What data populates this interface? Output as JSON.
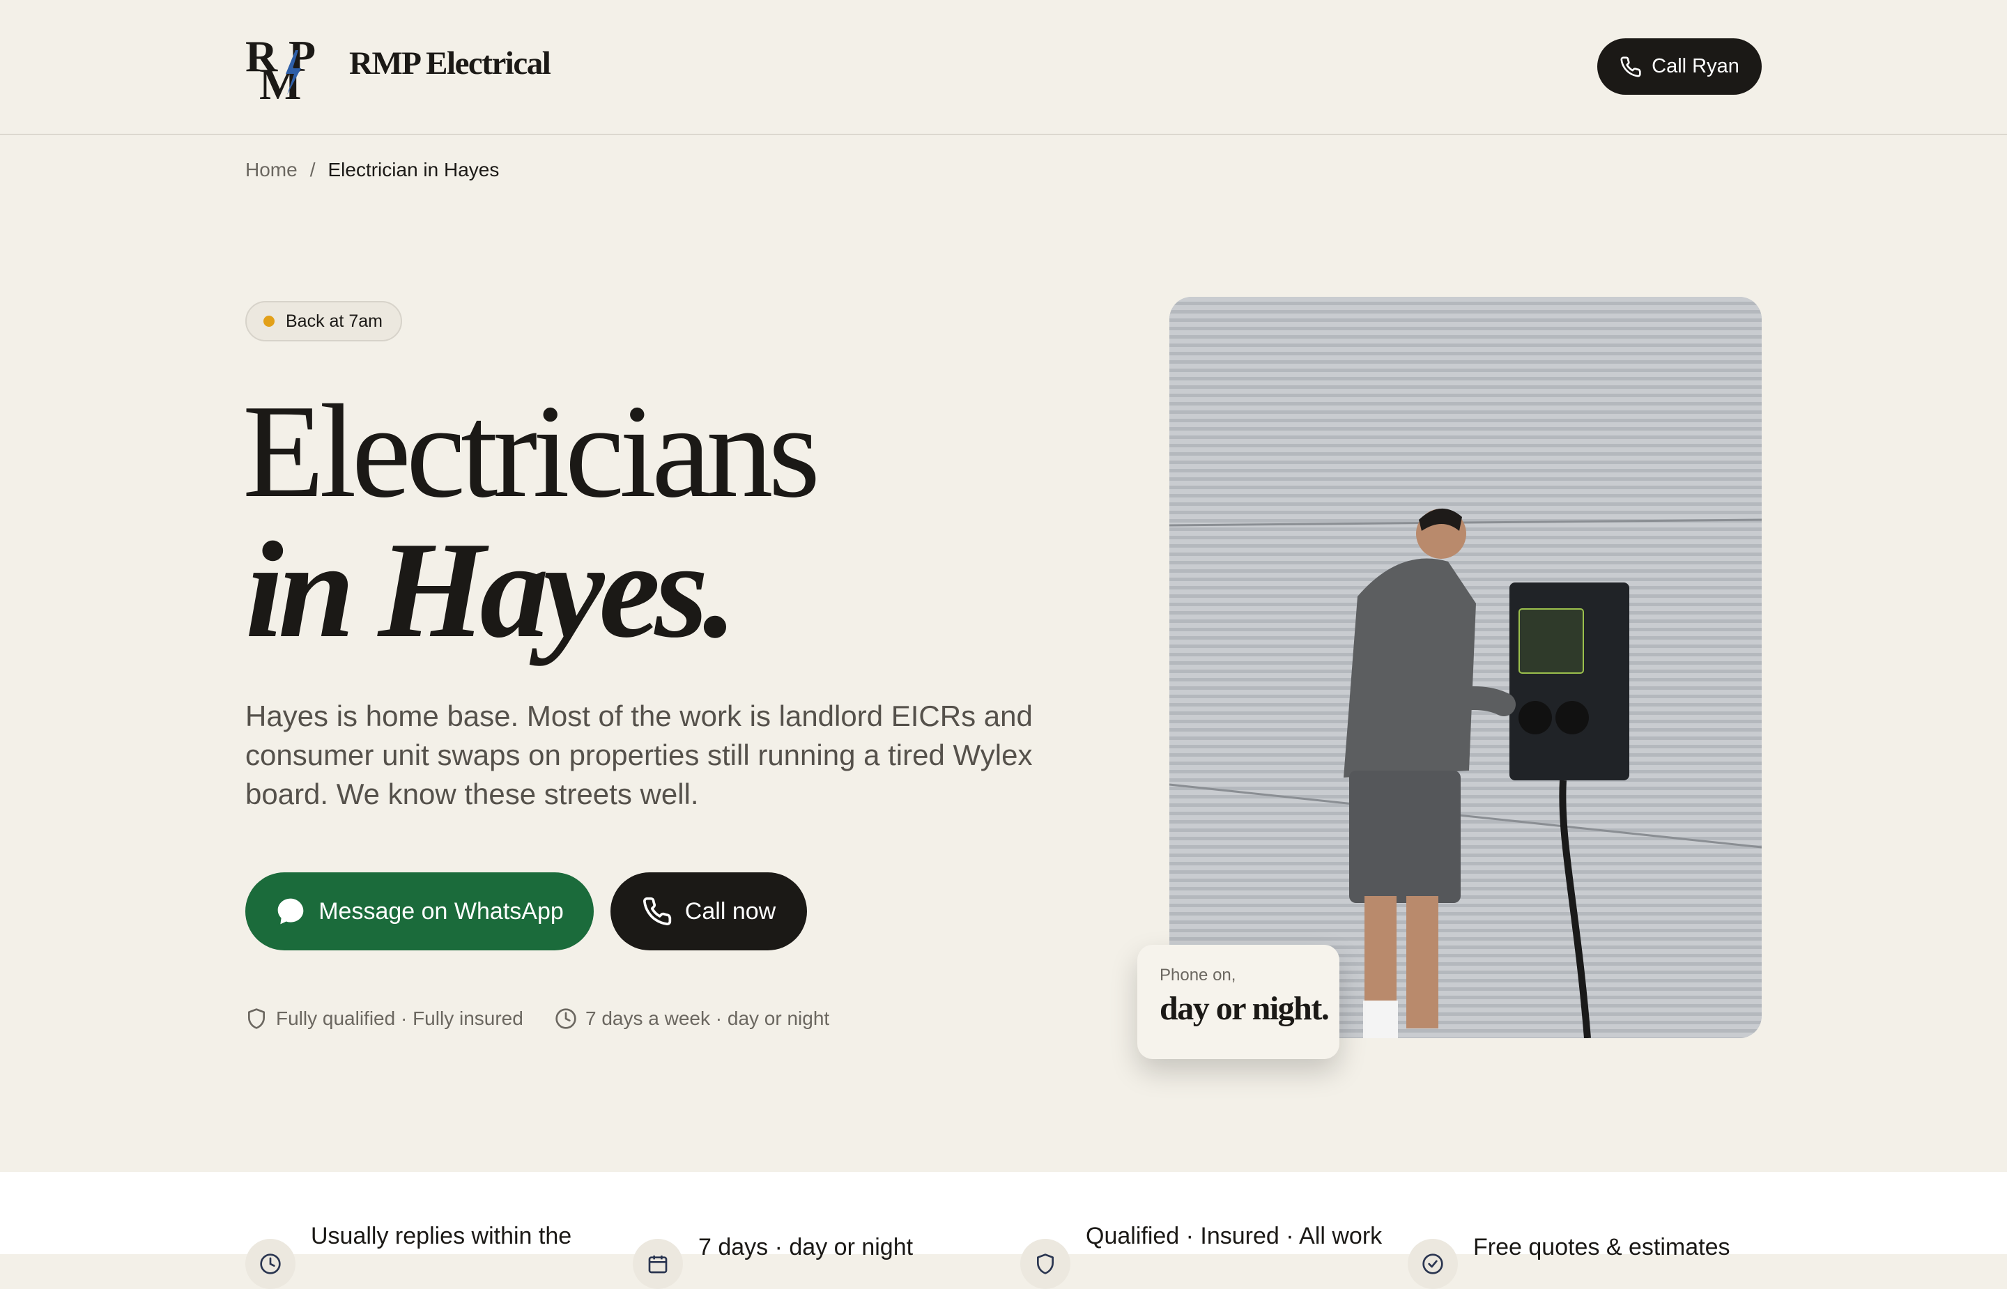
{
  "header": {
    "logo_mark": "RMP",
    "logo_text": "RMP Electrical",
    "call_button": "Call Ryan"
  },
  "breadcrumb": {
    "home": "Home",
    "separator": "/",
    "current": "Electrician in Hayes"
  },
  "hero": {
    "badge": "Back at 7am",
    "title_line1": "Electricians",
    "title_line2": "in Hayes.",
    "lead": "Hayes is home base. Most of the work is landlord EICRs and consumer unit swaps on properties still running a tired Wylex board. We know these streets well.",
    "whatsapp_button": "Message on WhatsApp",
    "call_button": "Call now",
    "trust": [
      {
        "icon": "shield-icon",
        "text": "Fully qualified · Fully insured"
      },
      {
        "icon": "clock-icon",
        "text": "7 days a week · day or night"
      }
    ]
  },
  "photo_card": {
    "small": "Phone on,",
    "big": "day or night."
  },
  "features": [
    {
      "icon": "clock-icon",
      "text": "Usually replies within the"
    },
    {
      "icon": "calendar-icon",
      "text": "7 days · day or night"
    },
    {
      "icon": "shield-icon",
      "text": "Qualified · Insured · All work"
    },
    {
      "icon": "check-circle-icon",
      "text": "Free quotes & estimates"
    }
  ],
  "colors": {
    "background": "#f3f0e8",
    "dark": "#1b1916",
    "whatsapp_green": "#1b6b3b",
    "status_dot": "#e2a019"
  }
}
